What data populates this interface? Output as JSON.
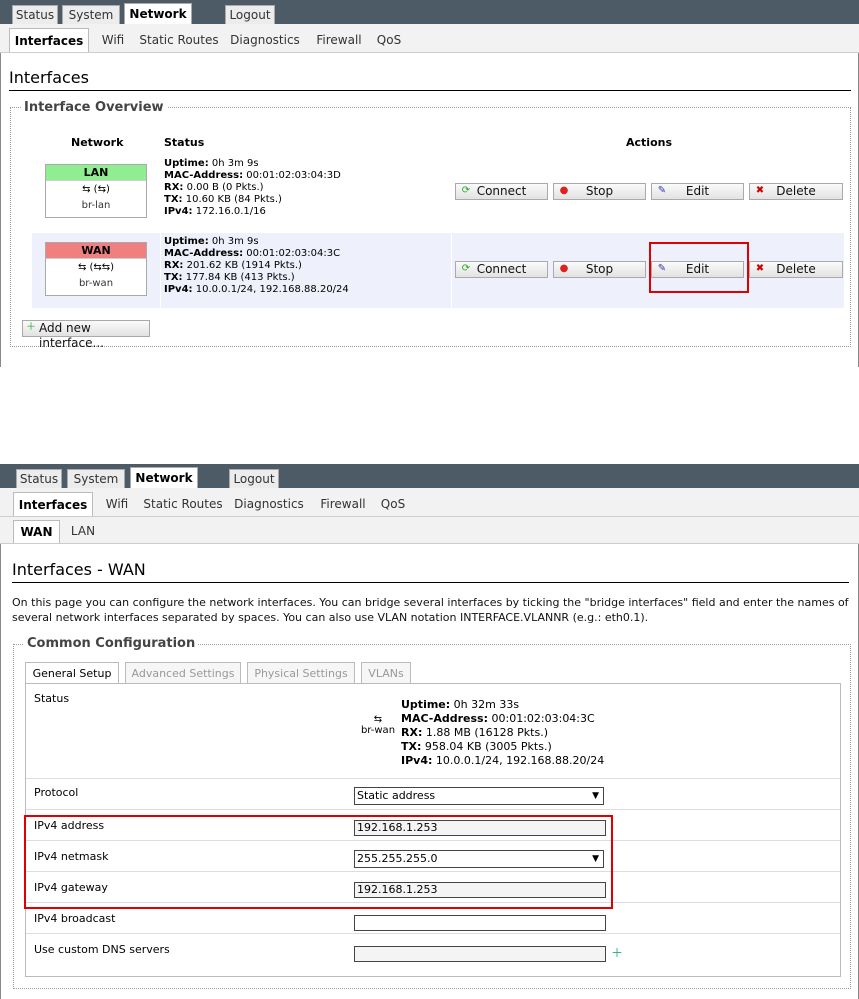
{
  "nav": {
    "top_tabs": [
      "Status",
      "System",
      "Network",
      "Logout"
    ],
    "sub_tabs": [
      "Interfaces",
      "Wifi",
      "Static Routes",
      "Diagnostics",
      "Firewall",
      "QoS"
    ]
  },
  "panel1": {
    "title": "Interfaces",
    "fieldset_legend": "Interface Overview",
    "headers": {
      "network": "Network",
      "status": "Status",
      "actions": "Actions"
    },
    "interfaces": [
      {
        "name": "LAN",
        "color": "#90ee90",
        "glyph": "⇆ (⇆)",
        "device": "br-lan",
        "uptime_label": "Uptime:",
        "uptime": "0h 3m 9s",
        "mac_label": "MAC-Address:",
        "mac": "00:01:02:03:04:3D",
        "rx_label": "RX:",
        "rx": "0.00 B (0 Pkts.)",
        "tx_label": "TX:",
        "tx": "10.60 KB (84 Pkts.)",
        "ipv4_label": "IPv4:",
        "ipv4": "172.16.0.1/16"
      },
      {
        "name": "WAN",
        "color": "#f08080",
        "glyph": "⇆ (⇆⇆)",
        "device": "br-wan",
        "uptime_label": "Uptime:",
        "uptime": "0h 3m 9s",
        "mac_label": "MAC-Address:",
        "mac": "00:01:02:03:04:3C",
        "rx_label": "RX:",
        "rx": "201.62 KB (1914 Pkts.)",
        "tx_label": "TX:",
        "tx": "177.84 KB (413 Pkts.)",
        "ipv4_label": "IPv4:",
        "ipv4": "10.0.0.1/24, 192.168.88.20/24"
      }
    ],
    "buttons": {
      "connect": "Connect",
      "stop": "Stop",
      "edit": "Edit",
      "delete": "Delete"
    },
    "add_button": "Add new interface..."
  },
  "panel2": {
    "sub_tabs2": [
      "WAN",
      "LAN"
    ],
    "title": "Interfaces - WAN",
    "description_line1": "On this page you can configure the network interfaces. You can bridge several interfaces by ticking the \"bridge interfaces\" field and enter the names of",
    "description_line2": "several network interfaces separated by spaces. You can also use VLAN notation INTERFACE.VLANNR (e.g.: eth0.1).",
    "fieldset_legend": "Common Configuration",
    "config_tabs": [
      "General Setup",
      "Advanced Settings",
      "Physical Settings",
      "VLANs"
    ],
    "status_label": "Status",
    "status": {
      "device": "br-wan",
      "uptime_label": "Uptime:",
      "uptime": "0h 32m 33s",
      "mac_label": "MAC-Address:",
      "mac": "00:01:02:03:04:3C",
      "rx_label": "RX:",
      "rx": "1.88 MB (16128 Pkts.)",
      "tx_label": "TX:",
      "tx": "958.04 KB (3005 Pkts.)",
      "ipv4_label": "IPv4:",
      "ipv4": "10.0.0.1/24, 192.168.88.20/24"
    },
    "fields": {
      "protocol_label": "Protocol",
      "protocol_value": "Static address",
      "ipv4_address_label": "IPv4 address",
      "ipv4_address_value": "192.168.1.253",
      "ipv4_netmask_label": "IPv4 netmask",
      "ipv4_netmask_value": "255.255.255.0",
      "ipv4_gateway_label": "IPv4 gateway",
      "ipv4_gateway_value": "192.168.1.253",
      "ipv4_broadcast_label": "IPv4 broadcast",
      "ipv4_broadcast_value": "",
      "dns_label": "Use custom DNS servers",
      "dns_value": ""
    }
  },
  "colors": {
    "highlight": "#e00000",
    "topbar": "#4c5b66",
    "wan_row": "#eef0fb"
  }
}
